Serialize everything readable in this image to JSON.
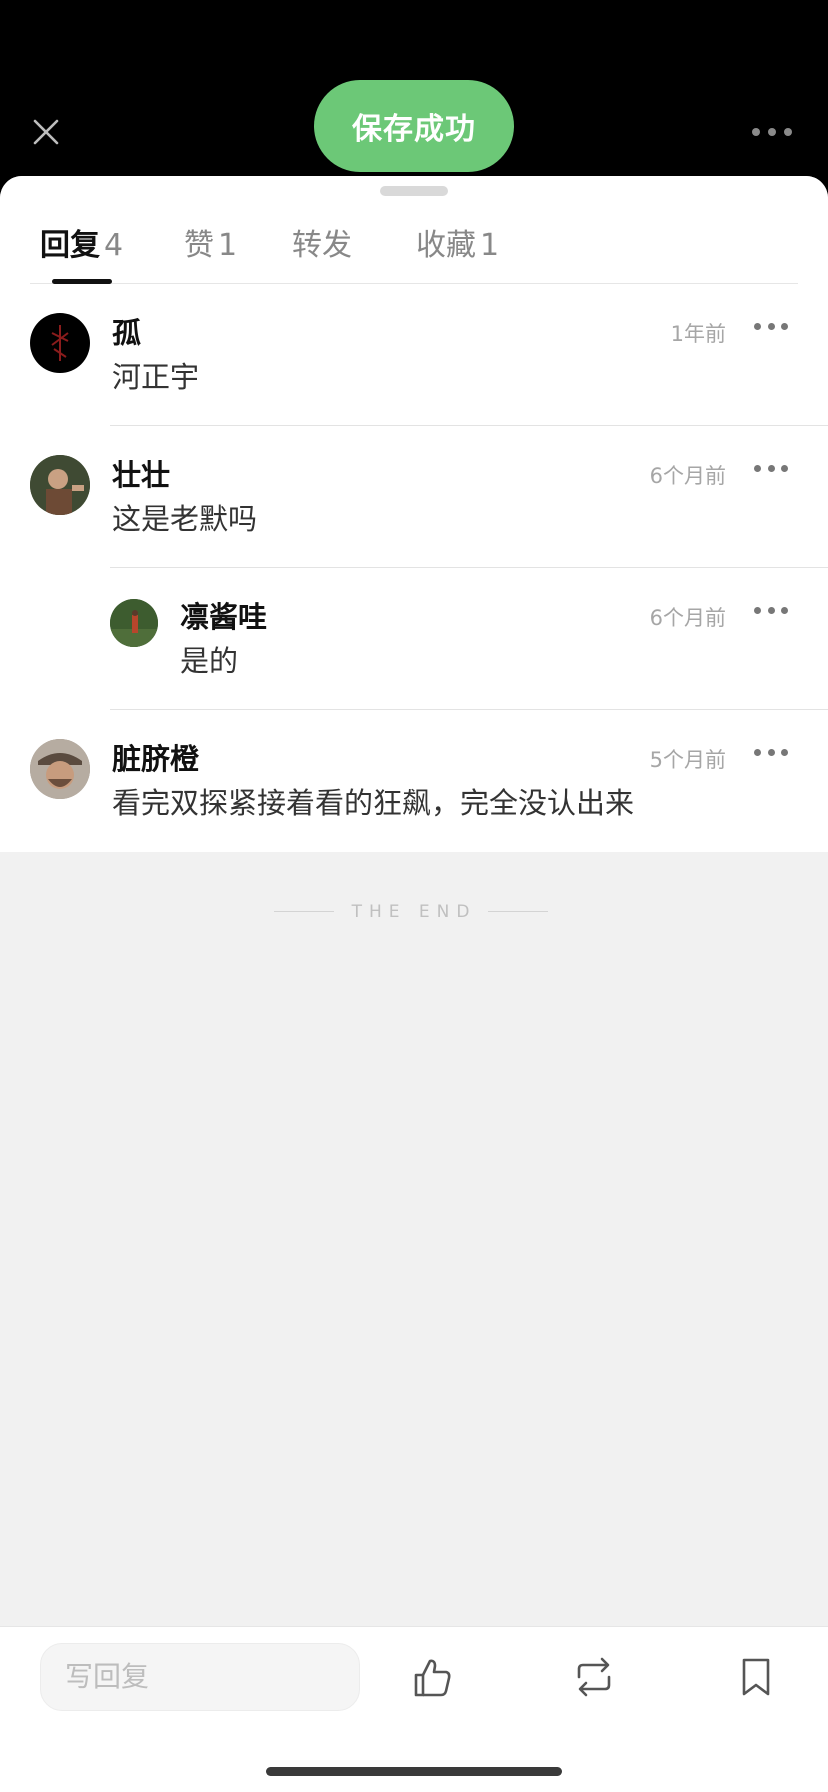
{
  "toast": {
    "text": "保存成功",
    "color": "#6cc877"
  },
  "topbar": {
    "close_icon": "close-icon",
    "more_icon": "more-horizontal-icon"
  },
  "tabs": [
    {
      "label": "回复",
      "count": "4",
      "active": true
    },
    {
      "label": "赞",
      "count": "1",
      "active": false
    },
    {
      "label": "转发",
      "count": "",
      "active": false
    },
    {
      "label": "收藏",
      "count": "1",
      "active": false
    }
  ],
  "comments": [
    {
      "name": "孤",
      "text": "河正宇",
      "time": "1年前",
      "avatar": "avatar-icon"
    },
    {
      "name": "壮壮",
      "text": "这是老默吗",
      "time": "6个月前",
      "avatar": "avatar-icon"
    },
    {
      "name": "凛酱哇",
      "text": "是的",
      "time": "6个月前",
      "avatar": "avatar-icon",
      "reply": true
    },
    {
      "name": "脏脐橙",
      "text": "看完双探紧接着看的狂飙，完全没认出来",
      "time": "5个月前",
      "avatar": "avatar-icon"
    }
  ],
  "end_text": "THE END",
  "bottombar": {
    "reply_placeholder": "写回复",
    "like_icon": "thumbs-up-icon",
    "repost_icon": "repost-icon",
    "bookmark_icon": "bookmark-icon"
  }
}
